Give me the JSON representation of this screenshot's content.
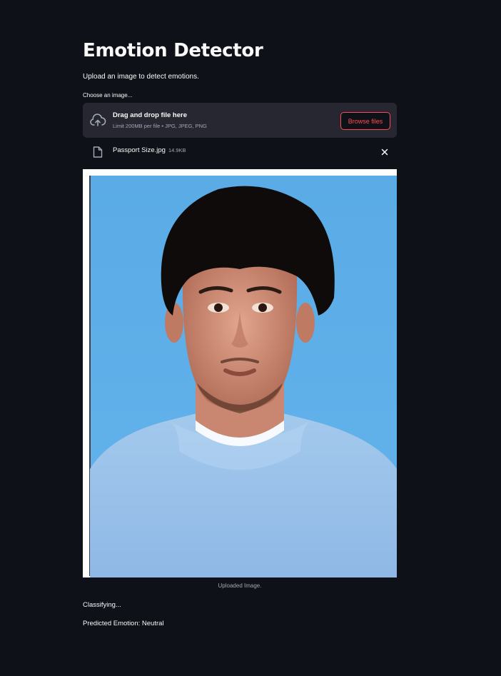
{
  "page": {
    "title": "Emotion Detector",
    "subtitle": "Upload an image to detect emotions."
  },
  "uploader": {
    "label": "Choose an image...",
    "drop_text": "Drag and drop file here",
    "limit_text": "Limit 200MB per file • JPG, JPEG, PNG",
    "browse_label": "Browse files",
    "icons": {
      "upload": "cloud-upload-icon",
      "file": "file-icon",
      "remove": "close-icon"
    }
  },
  "uploaded_file": {
    "name": "Passport Size.jpg",
    "size": "14.9KB"
  },
  "image": {
    "caption": "Uploaded Image."
  },
  "output": {
    "status": "Classifying...",
    "prediction": "Predicted Emotion: Neutral"
  },
  "colors": {
    "background": "#0e1117",
    "panel": "#262730",
    "accent": "#ff4b4b",
    "text": "#fafafa",
    "muted": "#a3a8b4"
  }
}
